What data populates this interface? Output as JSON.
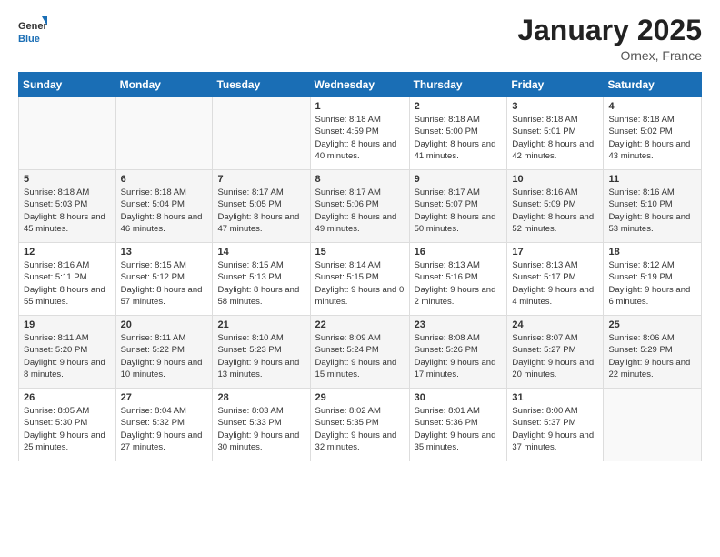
{
  "logo": {
    "general": "General",
    "blue": "Blue"
  },
  "header": {
    "month": "January 2025",
    "location": "Ornex, France"
  },
  "weekdays": [
    "Sunday",
    "Monday",
    "Tuesday",
    "Wednesday",
    "Thursday",
    "Friday",
    "Saturday"
  ],
  "weeks": [
    [
      {
        "day": "",
        "sunrise": "",
        "sunset": "",
        "daylight": ""
      },
      {
        "day": "",
        "sunrise": "",
        "sunset": "",
        "daylight": ""
      },
      {
        "day": "",
        "sunrise": "",
        "sunset": "",
        "daylight": ""
      },
      {
        "day": "1",
        "sunrise": "Sunrise: 8:18 AM",
        "sunset": "Sunset: 4:59 PM",
        "daylight": "Daylight: 8 hours and 40 minutes."
      },
      {
        "day": "2",
        "sunrise": "Sunrise: 8:18 AM",
        "sunset": "Sunset: 5:00 PM",
        "daylight": "Daylight: 8 hours and 41 minutes."
      },
      {
        "day": "3",
        "sunrise": "Sunrise: 8:18 AM",
        "sunset": "Sunset: 5:01 PM",
        "daylight": "Daylight: 8 hours and 42 minutes."
      },
      {
        "day": "4",
        "sunrise": "Sunrise: 8:18 AM",
        "sunset": "Sunset: 5:02 PM",
        "daylight": "Daylight: 8 hours and 43 minutes."
      }
    ],
    [
      {
        "day": "5",
        "sunrise": "Sunrise: 8:18 AM",
        "sunset": "Sunset: 5:03 PM",
        "daylight": "Daylight: 8 hours and 45 minutes."
      },
      {
        "day": "6",
        "sunrise": "Sunrise: 8:18 AM",
        "sunset": "Sunset: 5:04 PM",
        "daylight": "Daylight: 8 hours and 46 minutes."
      },
      {
        "day": "7",
        "sunrise": "Sunrise: 8:17 AM",
        "sunset": "Sunset: 5:05 PM",
        "daylight": "Daylight: 8 hours and 47 minutes."
      },
      {
        "day": "8",
        "sunrise": "Sunrise: 8:17 AM",
        "sunset": "Sunset: 5:06 PM",
        "daylight": "Daylight: 8 hours and 49 minutes."
      },
      {
        "day": "9",
        "sunrise": "Sunrise: 8:17 AM",
        "sunset": "Sunset: 5:07 PM",
        "daylight": "Daylight: 8 hours and 50 minutes."
      },
      {
        "day": "10",
        "sunrise": "Sunrise: 8:16 AM",
        "sunset": "Sunset: 5:09 PM",
        "daylight": "Daylight: 8 hours and 52 minutes."
      },
      {
        "day": "11",
        "sunrise": "Sunrise: 8:16 AM",
        "sunset": "Sunset: 5:10 PM",
        "daylight": "Daylight: 8 hours and 53 minutes."
      }
    ],
    [
      {
        "day": "12",
        "sunrise": "Sunrise: 8:16 AM",
        "sunset": "Sunset: 5:11 PM",
        "daylight": "Daylight: 8 hours and 55 minutes."
      },
      {
        "day": "13",
        "sunrise": "Sunrise: 8:15 AM",
        "sunset": "Sunset: 5:12 PM",
        "daylight": "Daylight: 8 hours and 57 minutes."
      },
      {
        "day": "14",
        "sunrise": "Sunrise: 8:15 AM",
        "sunset": "Sunset: 5:13 PM",
        "daylight": "Daylight: 8 hours and 58 minutes."
      },
      {
        "day": "15",
        "sunrise": "Sunrise: 8:14 AM",
        "sunset": "Sunset: 5:15 PM",
        "daylight": "Daylight: 9 hours and 0 minutes."
      },
      {
        "day": "16",
        "sunrise": "Sunrise: 8:13 AM",
        "sunset": "Sunset: 5:16 PM",
        "daylight": "Daylight: 9 hours and 2 minutes."
      },
      {
        "day": "17",
        "sunrise": "Sunrise: 8:13 AM",
        "sunset": "Sunset: 5:17 PM",
        "daylight": "Daylight: 9 hours and 4 minutes."
      },
      {
        "day": "18",
        "sunrise": "Sunrise: 8:12 AM",
        "sunset": "Sunset: 5:19 PM",
        "daylight": "Daylight: 9 hours and 6 minutes."
      }
    ],
    [
      {
        "day": "19",
        "sunrise": "Sunrise: 8:11 AM",
        "sunset": "Sunset: 5:20 PM",
        "daylight": "Daylight: 9 hours and 8 minutes."
      },
      {
        "day": "20",
        "sunrise": "Sunrise: 8:11 AM",
        "sunset": "Sunset: 5:22 PM",
        "daylight": "Daylight: 9 hours and 10 minutes."
      },
      {
        "day": "21",
        "sunrise": "Sunrise: 8:10 AM",
        "sunset": "Sunset: 5:23 PM",
        "daylight": "Daylight: 9 hours and 13 minutes."
      },
      {
        "day": "22",
        "sunrise": "Sunrise: 8:09 AM",
        "sunset": "Sunset: 5:24 PM",
        "daylight": "Daylight: 9 hours and 15 minutes."
      },
      {
        "day": "23",
        "sunrise": "Sunrise: 8:08 AM",
        "sunset": "Sunset: 5:26 PM",
        "daylight": "Daylight: 9 hours and 17 minutes."
      },
      {
        "day": "24",
        "sunrise": "Sunrise: 8:07 AM",
        "sunset": "Sunset: 5:27 PM",
        "daylight": "Daylight: 9 hours and 20 minutes."
      },
      {
        "day": "25",
        "sunrise": "Sunrise: 8:06 AM",
        "sunset": "Sunset: 5:29 PM",
        "daylight": "Daylight: 9 hours and 22 minutes."
      }
    ],
    [
      {
        "day": "26",
        "sunrise": "Sunrise: 8:05 AM",
        "sunset": "Sunset: 5:30 PM",
        "daylight": "Daylight: 9 hours and 25 minutes."
      },
      {
        "day": "27",
        "sunrise": "Sunrise: 8:04 AM",
        "sunset": "Sunset: 5:32 PM",
        "daylight": "Daylight: 9 hours and 27 minutes."
      },
      {
        "day": "28",
        "sunrise": "Sunrise: 8:03 AM",
        "sunset": "Sunset: 5:33 PM",
        "daylight": "Daylight: 9 hours and 30 minutes."
      },
      {
        "day": "29",
        "sunrise": "Sunrise: 8:02 AM",
        "sunset": "Sunset: 5:35 PM",
        "daylight": "Daylight: 9 hours and 32 minutes."
      },
      {
        "day": "30",
        "sunrise": "Sunrise: 8:01 AM",
        "sunset": "Sunset: 5:36 PM",
        "daylight": "Daylight: 9 hours and 35 minutes."
      },
      {
        "day": "31",
        "sunrise": "Sunrise: 8:00 AM",
        "sunset": "Sunset: 5:37 PM",
        "daylight": "Daylight: 9 hours and 37 minutes."
      },
      {
        "day": "",
        "sunrise": "",
        "sunset": "",
        "daylight": ""
      }
    ]
  ]
}
